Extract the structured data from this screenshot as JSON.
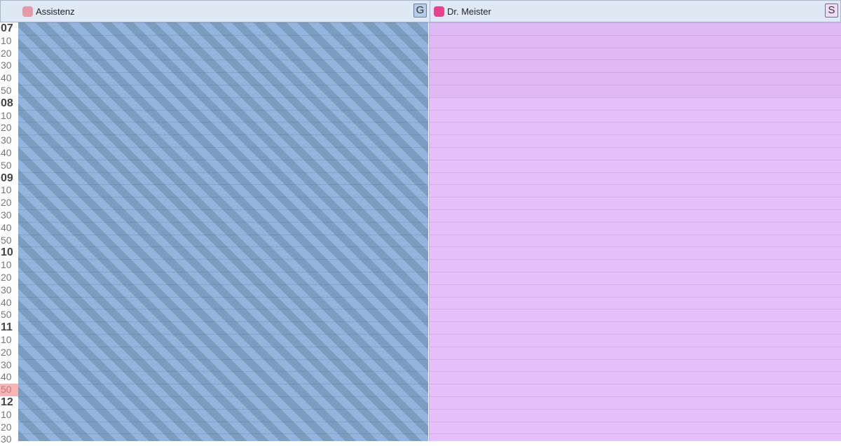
{
  "columns": [
    {
      "title": "Assistenz",
      "button": "G",
      "color": "#e49aa8"
    },
    {
      "title": "Dr. Meister",
      "button": "S",
      "color": "#e8428f"
    }
  ],
  "time_labels": [
    "07",
    "10",
    "20",
    "30",
    "40",
    "50",
    "08",
    "10",
    "20",
    "30",
    "40",
    "50",
    "09",
    "10",
    "20",
    "30",
    "40",
    "50",
    "10",
    "10",
    "20",
    "30",
    "40",
    "50",
    "11",
    "10",
    "20",
    "30",
    "40",
    "50",
    "12",
    "10",
    "20",
    "30"
  ],
  "current_time_label": "50"
}
